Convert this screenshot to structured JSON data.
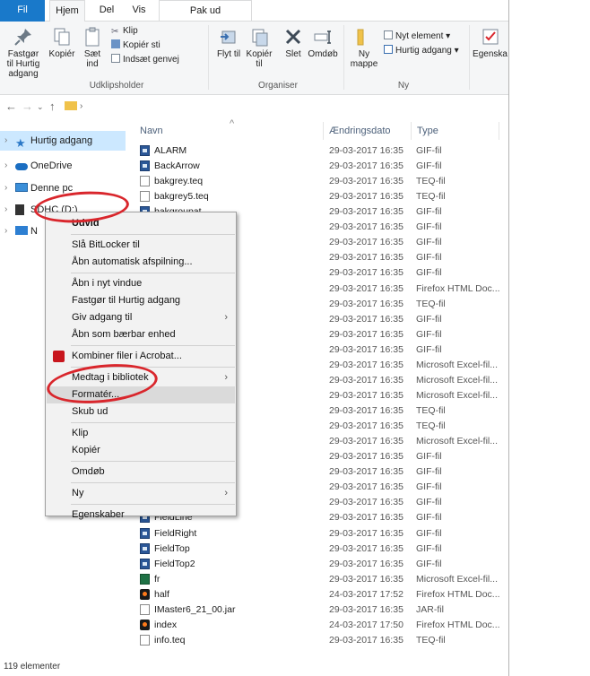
{
  "tabs": [
    "Fil",
    "Hjem",
    "Del",
    "Vis",
    "Pak ud"
  ],
  "ribbon": {
    "pin_label": "Fastgør til Hurtig adgang",
    "copy_label": "Kopiér",
    "paste_label": "Sæt ind",
    "cut_label": "Klip",
    "copy_path_label": "Kopiér sti",
    "paste_shortcut_label": "Indsæt genvej",
    "group_clipboard": "Udklipsholder",
    "move_label": "Flyt til",
    "copyto_label": "Kopiér til",
    "delete_label": "Slet",
    "rename_label": "Omdøb",
    "group_organize": "Organiser",
    "newfolder_label": "Ny mappe",
    "newitem_label": "Nyt element",
    "easyaccess_label": "Hurtig adgang",
    "group_new": "Ny",
    "properties_label": "Egenska"
  },
  "columns": {
    "name": "Navn",
    "date": "Ændringsdato",
    "type": "Type"
  },
  "nav": [
    {
      "label": "Hurtig adgang",
      "icon": "star-icon"
    },
    {
      "label": "OneDrive",
      "icon": "cloud-icon"
    },
    {
      "label": "Denne pc",
      "icon": "computer-icon"
    },
    {
      "label": "SDHC (D:)",
      "icon": "sd-card-icon"
    },
    {
      "label": "N",
      "icon": "network-icon"
    }
  ],
  "files": [
    {
      "name": "ALARM",
      "date": "29-03-2017 16:35",
      "type": "GIF-fil",
      "icon": "gif"
    },
    {
      "name": "BackArrow",
      "date": "29-03-2017 16:35",
      "type": "GIF-fil",
      "icon": "gif"
    },
    {
      "name": "bakgrey.teq",
      "date": "29-03-2017 16:35",
      "type": "TEQ-fil",
      "icon": "doc"
    },
    {
      "name": "bakgrey5.teq",
      "date": "29-03-2017 16:35",
      "type": "TEQ-fil",
      "icon": "doc"
    },
    {
      "name": "bakgroupat",
      "date": "29-03-2017 16:35",
      "type": "GIF-fil",
      "icon": "gif"
    },
    {
      "name": "",
      "date": "29-03-2017 16:35",
      "type": "GIF-fil",
      "icon": "gif"
    },
    {
      "name": "",
      "date": "29-03-2017 16:35",
      "type": "GIF-fil",
      "icon": "gif"
    },
    {
      "name": "",
      "date": "29-03-2017 16:35",
      "type": "GIF-fil",
      "icon": "gif"
    },
    {
      "name": "",
      "date": "29-03-2017 16:35",
      "type": "GIF-fil",
      "icon": "gif"
    },
    {
      "name": "",
      "date": "29-03-2017 16:35",
      "type": "Firefox HTML Doc...",
      "icon": "ff"
    },
    {
      "name": "",
      "date": "29-03-2017 16:35",
      "type": "TEQ-fil",
      "icon": "doc"
    },
    {
      "name": "",
      "date": "29-03-2017 16:35",
      "type": "GIF-fil",
      "icon": "gif"
    },
    {
      "name": "",
      "date": "29-03-2017 16:35",
      "type": "GIF-fil",
      "icon": "gif"
    },
    {
      "name": "",
      "date": "29-03-2017 16:35",
      "type": "GIF-fil",
      "icon": "gif"
    },
    {
      "name": "",
      "date": "29-03-2017 16:35",
      "type": "Microsoft Excel-fil...",
      "icon": "xls"
    },
    {
      "name": "",
      "date": "29-03-2017 16:35",
      "type": "Microsoft Excel-fil...",
      "icon": "xls"
    },
    {
      "name": "",
      "date": "29-03-2017 16:35",
      "type": "Microsoft Excel-fil...",
      "icon": "xls"
    },
    {
      "name": "",
      "date": "29-03-2017 16:35",
      "type": "TEQ-fil",
      "icon": "doc"
    },
    {
      "name": "",
      "date": "29-03-2017 16:35",
      "type": "TEQ-fil",
      "icon": "doc"
    },
    {
      "name": "",
      "date": "29-03-2017 16:35",
      "type": "Microsoft Excel-fil...",
      "icon": "xls"
    },
    {
      "name": "",
      "date": "29-03-2017 16:35",
      "type": "GIF-fil",
      "icon": "gif"
    },
    {
      "name": "",
      "date": "29-03-2017 16:35",
      "type": "GIF-fil",
      "icon": "gif"
    },
    {
      "name": "",
      "date": "29-03-2017 16:35",
      "type": "GIF-fil",
      "icon": "gif"
    },
    {
      "name": "FieldLeft",
      "date": "29-03-2017 16:35",
      "type": "GIF-fil",
      "icon": "gif"
    },
    {
      "name": "FieldLine",
      "date": "29-03-2017 16:35",
      "type": "GIF-fil",
      "icon": "gif"
    },
    {
      "name": "FieldRight",
      "date": "29-03-2017 16:35",
      "type": "GIF-fil",
      "icon": "gif"
    },
    {
      "name": "FieldTop",
      "date": "29-03-2017 16:35",
      "type": "GIF-fil",
      "icon": "gif"
    },
    {
      "name": "FieldTop2",
      "date": "29-03-2017 16:35",
      "type": "GIF-fil",
      "icon": "gif"
    },
    {
      "name": "fr",
      "date": "29-03-2017 16:35",
      "type": "Microsoft Excel-fil...",
      "icon": "xls"
    },
    {
      "name": "half",
      "date": "24-03-2017 17:52",
      "type": "Firefox HTML Doc...",
      "icon": "ff"
    },
    {
      "name": "IMaster6_21_00.jar",
      "date": "29-03-2017 16:35",
      "type": "JAR-fil",
      "icon": "doc"
    },
    {
      "name": "index",
      "date": "24-03-2017 17:50",
      "type": "Firefox HTML Doc...",
      "icon": "ff"
    },
    {
      "name": "info.teq",
      "date": "29-03-2017 16:35",
      "type": "TEQ-fil",
      "icon": "doc"
    }
  ],
  "context_menu": [
    {
      "label": "Udvid",
      "bold": true
    },
    {
      "sep": true
    },
    {
      "label": "Slå BitLocker til"
    },
    {
      "label": "Åbn automatisk afspilning..."
    },
    {
      "sep": true
    },
    {
      "label": "Åbn i nyt vindue"
    },
    {
      "label": "Fastgør til Hurtig adgang"
    },
    {
      "label": "Giv adgang til",
      "submenu": true
    },
    {
      "label": "Åbn som bærbar enhed"
    },
    {
      "sep": true
    },
    {
      "label": "Kombiner filer i Acrobat...",
      "icon": "acrobat-icon"
    },
    {
      "sep": true
    },
    {
      "label": "Medtag i bibliotek",
      "submenu": true
    },
    {
      "label": "Formatér...",
      "highlight": true
    },
    {
      "label": "Skub ud"
    },
    {
      "sep": true
    },
    {
      "label": "Klip"
    },
    {
      "label": "Kopiér"
    },
    {
      "sep": true
    },
    {
      "label": "Omdøb"
    },
    {
      "sep": true
    },
    {
      "label": "Ny",
      "submenu": true
    },
    {
      "sep": true
    },
    {
      "label": "Egenskaber"
    }
  ],
  "status": "119 elementer",
  "colors": {
    "accent": "#1979ca",
    "selection": "#cce8ff",
    "annotation": "#d9262c"
  }
}
